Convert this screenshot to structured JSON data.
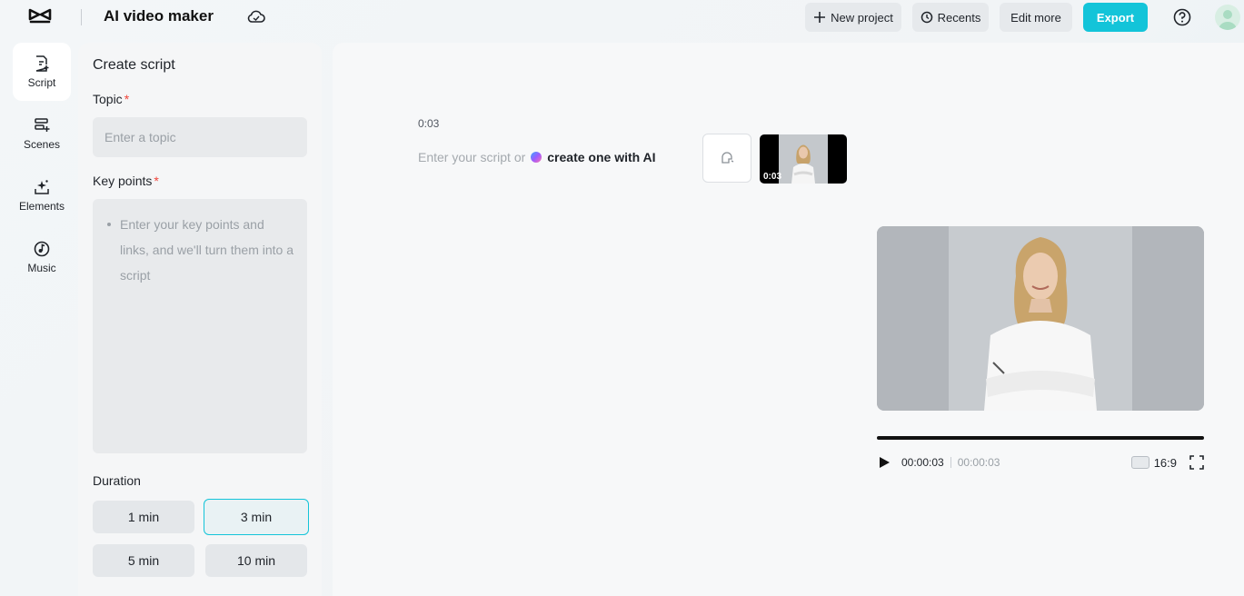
{
  "header": {
    "title": "AI video maker",
    "buttons": {
      "new_project": "New project",
      "recents": "Recents",
      "edit_more": "Edit more",
      "export": "Export"
    },
    "icons": [
      "capcut-logo-icon",
      "cloud-icon",
      "help-icon",
      "avatar"
    ],
    "accent_color": "#13c4d9"
  },
  "rail": {
    "items": [
      {
        "label": "Script",
        "icon": "script-icon",
        "active": true
      },
      {
        "label": "Scenes",
        "icon": "scenes-icon",
        "active": false
      },
      {
        "label": "Elements",
        "icon": "elements-icon",
        "active": false
      },
      {
        "label": "Music",
        "icon": "music-icon",
        "active": false
      }
    ]
  },
  "script_panel": {
    "title": "Create script",
    "topic_label": "Topic",
    "required_mark": "*",
    "topic_placeholder": "Enter a topic",
    "key_points_label": "Key points",
    "key_points_placeholder": "Enter your key points and links, and we'll turn them into a script",
    "duration_label": "Duration",
    "durations": [
      {
        "label": "1 min",
        "selected": false
      },
      {
        "label": "3 min",
        "selected": true
      },
      {
        "label": "5 min",
        "selected": false
      },
      {
        "label": "10 min",
        "selected": false
      }
    ]
  },
  "editor": {
    "scene_time": "0:03",
    "script_placeholder": "Enter your script or",
    "ai_link": "create one with AI",
    "thumbnail_time": "0:03"
  },
  "player": {
    "current_time": "00:00:03",
    "total_time": "00:00:03",
    "aspect_ratio": "16:9",
    "progress": 1.0
  }
}
